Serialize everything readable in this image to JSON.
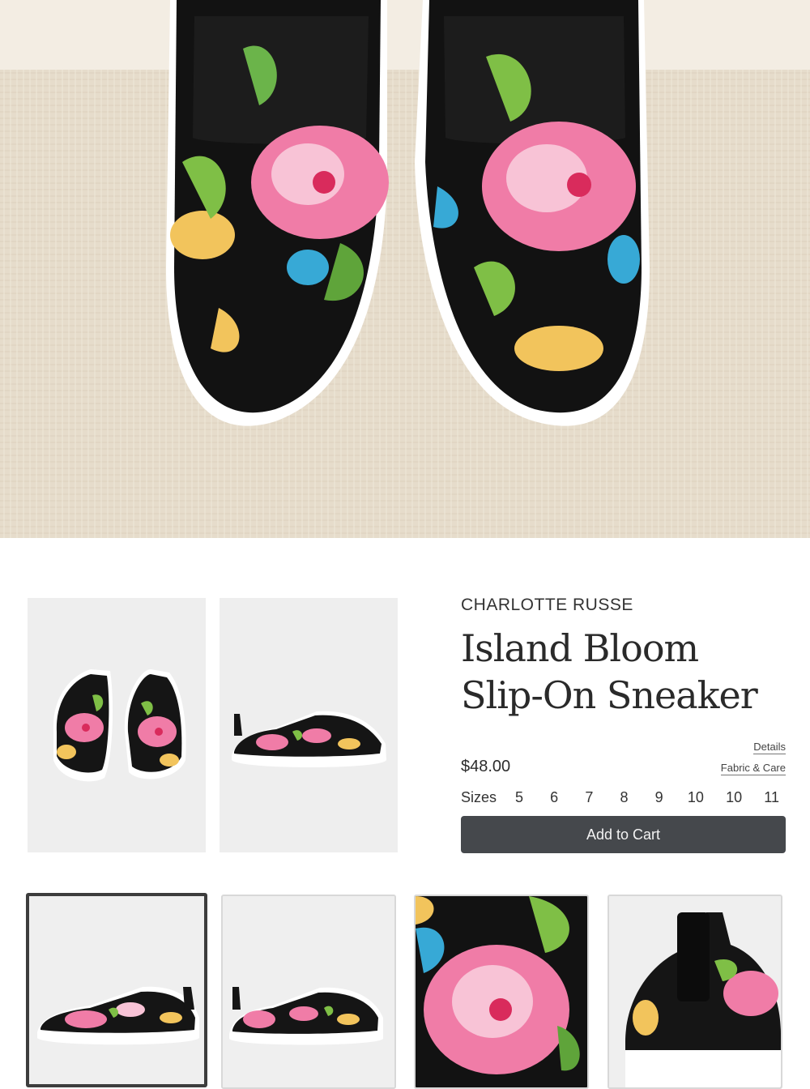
{
  "product": {
    "brand": "CHARLOTTE RUSSE",
    "title_line1": "Island Bloom",
    "title_line2": "Slip-On Sneaker",
    "price": "$48.00",
    "links": {
      "details": "Details",
      "fabric_care": "Fabric & Care"
    },
    "sizes_label": "Sizes",
    "sizes": [
      "5",
      "6",
      "7",
      "8",
      "9",
      "10",
      "10",
      "11"
    ],
    "add_to_cart_label": "Add to Cart"
  },
  "colors": {
    "button_bg": "#45484c",
    "button_text": "#f3f3f3",
    "thumb_bg": "#eeeeee",
    "active_thumb_border": "#3d3d3d",
    "hero_bg": "#ebe2d2",
    "shoe_black": "#121212",
    "hibiscus_pink": "#f07ca7",
    "leaf_green": "#7fbf46"
  },
  "icons": {
    "hero": "floral-slip-on-sneakers-top-view",
    "thumb_front": "sneakers-front-view",
    "thumb_side": "sneaker-side-view",
    "strip_1": "sneaker-side-view",
    "strip_2": "sneaker-side-view",
    "strip_3": "hibiscus-print-closeup",
    "strip_4": "sneaker-heel-closeup"
  },
  "gallery": {
    "active_index": 0,
    "count": 4
  }
}
